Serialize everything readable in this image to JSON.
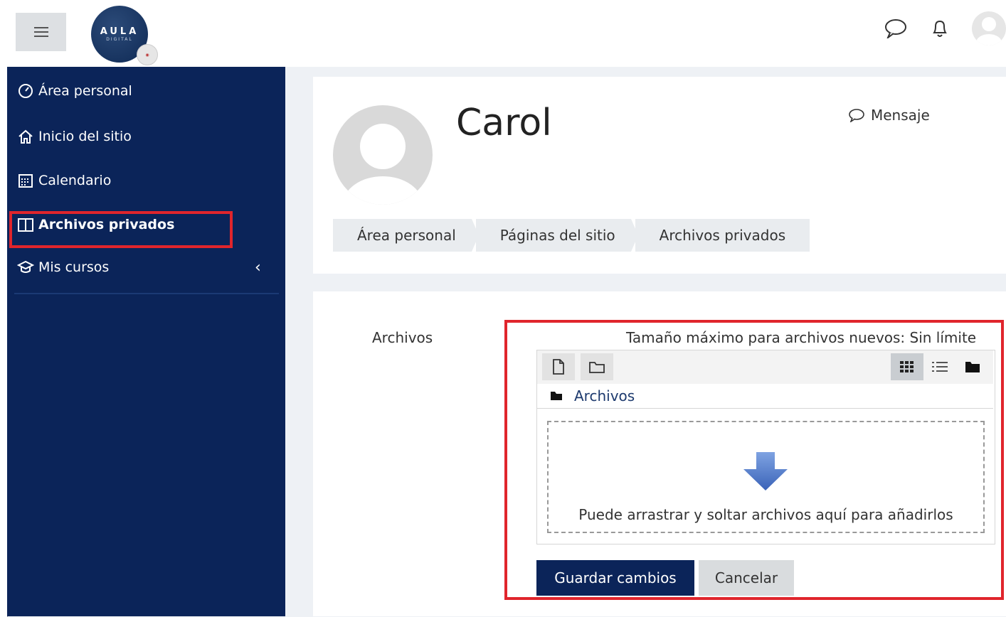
{
  "brand": {
    "logo_main": "AULA",
    "logo_sub": "DIGITAL"
  },
  "sidebar": {
    "items": [
      {
        "label": "Área personal",
        "icon": "dashboard-icon"
      },
      {
        "label": "Inicio del sitio",
        "icon": "home-icon"
      },
      {
        "label": "Calendario",
        "icon": "calendar-icon"
      },
      {
        "label": "Archivos privados",
        "icon": "files-icon",
        "active": true
      },
      {
        "label": "Mis cursos",
        "icon": "graduation-cap-icon"
      }
    ]
  },
  "profile": {
    "name": "Carol",
    "message_label": "Mensaje"
  },
  "breadcrumb": [
    "Área personal",
    "Páginas del sitio",
    "Archivos privados"
  ],
  "files": {
    "label": "Archivos",
    "max_size": "Tamaño máximo para archivos nuevos: Sin límite",
    "path": "Archivos",
    "drop_hint": "Puede arrastrar y soltar archivos aquí para añadirlos"
  },
  "actions": {
    "save_label": "Guardar cambios",
    "cancel_label": "Cancelar"
  },
  "colors": {
    "sidebar_bg": "#0b2459",
    "highlight": "#e0252c",
    "arrow": "#4a78c8"
  }
}
